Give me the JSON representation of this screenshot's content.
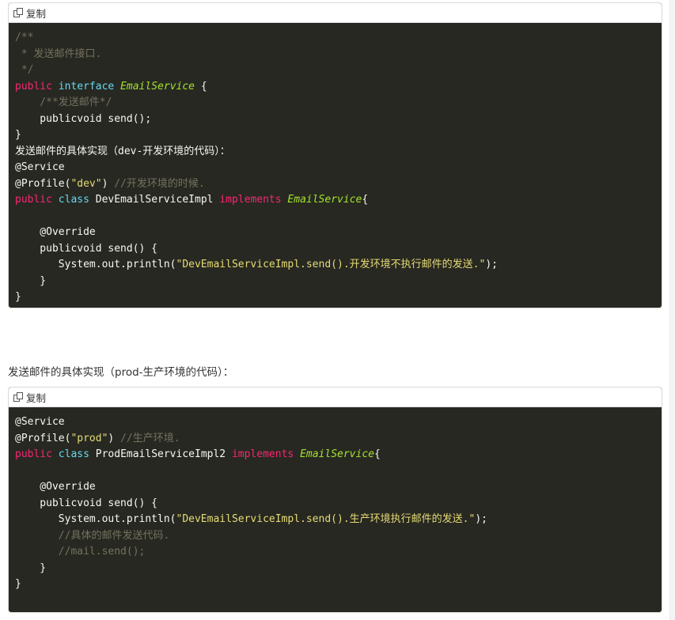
{
  "toolbar": {
    "copy_label": "复制",
    "copy_icon": "copy-icon"
  },
  "block1": {
    "l1": "/**",
    "l2": " * 发送邮件接口.",
    "l3": " */",
    "l4_kw1": "public",
    "l4_kw2": "interface",
    "l4_type": "EmailService",
    "l4_rest": " {",
    "l5": "    /**发送邮件*/",
    "l6": "    publicvoid send();",
    "l7": "}",
    "l8": "发送邮件的具体实现（dev-开发环境的代码）：",
    "l9": "@Service",
    "l10_a": "@Profile(",
    "l10_str": "\"dev\"",
    "l10_b": ") ",
    "l10_cm": "//开发环境的时候.",
    "l11_kw1": "public",
    "l11_kw2": "class",
    "l11_name": " DevEmailServiceImpl ",
    "l11_kw3": "implements",
    "l11_type": "EmailService",
    "l11_rest": "{",
    "l12": "",
    "l13": "    @Override",
    "l14": "    publicvoid send() {",
    "l15_a": "       System.out.println(",
    "l15_str": "\"DevEmailServiceImpl.send().开发环境不执行邮件的发送.\"",
    "l15_b": ");",
    "l16": "    }",
    "l17": "}"
  },
  "prose_line": "发送邮件的具体实现（prod-生产环境的代码）：",
  "block2": {
    "l1": "@Service",
    "l2_a": "@Profile(",
    "l2_str": "\"prod\"",
    "l2_b": ") ",
    "l2_cm": "//生产环境.",
    "l3_kw1": "public",
    "l3_kw2": "class",
    "l3_name": " ProdEmailServiceImpl2 ",
    "l3_kw3": "implements",
    "l3_type": "EmailService",
    "l3_rest": "{",
    "l4": "",
    "l5": "    @Override",
    "l6": "    publicvoid send() {",
    "l7_a": "       System.out.println(",
    "l7_str": "\"DevEmailServiceImpl.send().生产环境执行邮件的发送.\"",
    "l7_b": ");",
    "l8": "       //具体的邮件发送代码.",
    "l9": "       //mail.send();",
    "l10": "    }",
    "l11": "}"
  }
}
